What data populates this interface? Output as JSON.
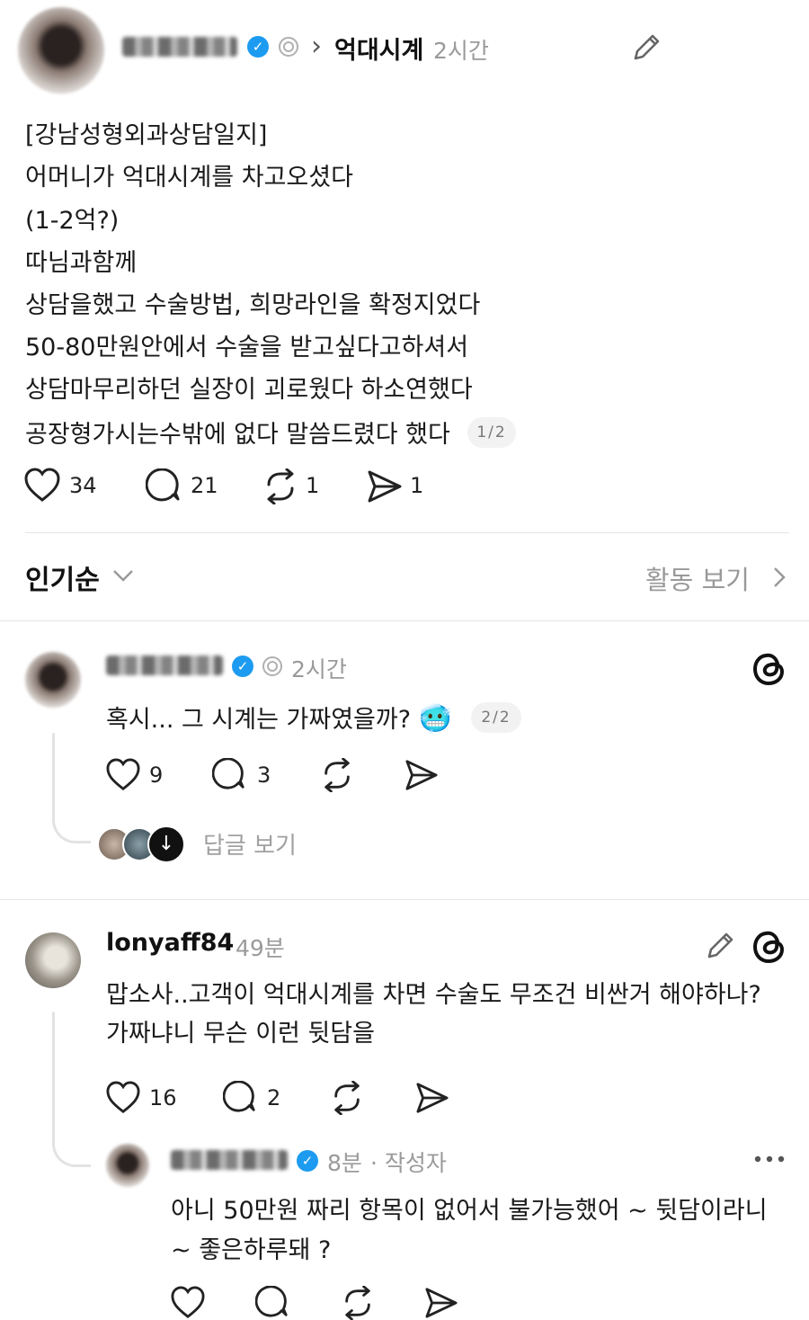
{
  "header": {
    "topic": "억대시계",
    "time": "2시간",
    "arrow": "›"
  },
  "post": {
    "lines": [
      "[강남성형외과상담일지]",
      "어머니가 억대시계를 차고오셨다",
      "(1-2억?)",
      "따님과함께",
      "상담을했고 수술방법, 희망라인을 확정지었다",
      "50-80만원안에서 수술을 받고싶다고하셔서",
      "상담마무리하던 실장이 괴로웠다 하소연했다",
      "공장형가시는수밖에 없다 말씀드렸다 했다"
    ],
    "page": "1/2",
    "likes": "34",
    "comments": "21",
    "reposts": "1",
    "shares": "1"
  },
  "sort_bar": {
    "sort_label": "인기순",
    "activity_label": "활동 보기"
  },
  "reply1": {
    "time": "2시간",
    "text": "혹시... 그 시계는 가짜였을까?",
    "emoji": "🥶",
    "page": "2/2",
    "likes": "9",
    "comments": "3",
    "view_replies": "답글 보기"
  },
  "reply2": {
    "username": "lonyaff84",
    "time": "49분",
    "text_lines": [
      "맙소사..고객이 억대시계를 차면 수술도 무조건 비싼거 해야하나?",
      "가짜냐니 무슨 이런 뒷담을"
    ],
    "likes": "16",
    "comments": "2"
  },
  "reply3": {
    "time": "8분",
    "author_tag": "· 작성자",
    "text_lines": [
      "아니 50만원 짜리 항목이 없어서 불가능했어 ~ 뒷담이라니",
      "~ 좋은하루돼 ?"
    ]
  },
  "colors": {
    "verified": "#1d9bf0",
    "muted": "#9a9a9a"
  }
}
